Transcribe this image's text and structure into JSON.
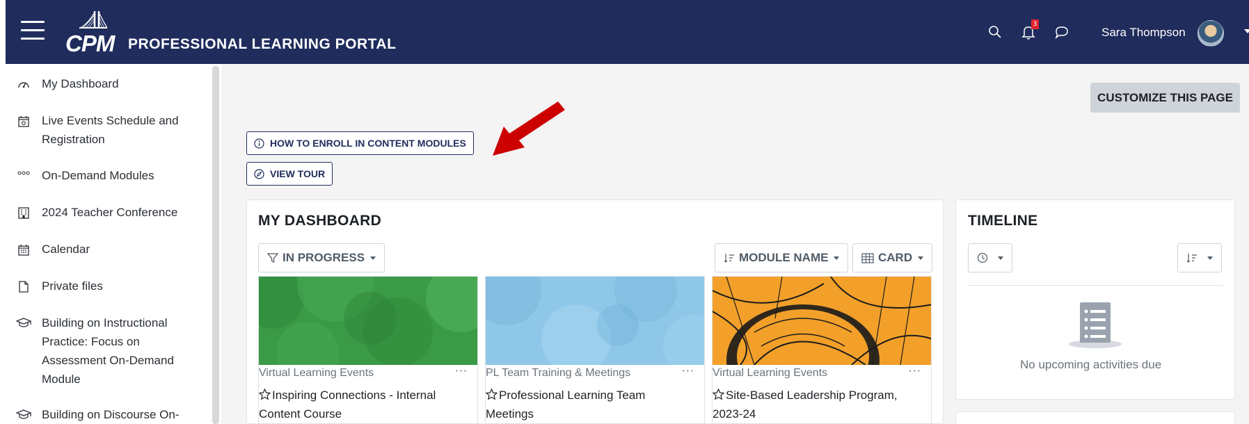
{
  "header": {
    "logo_text": "CPM",
    "portal_title": "PROFESSIONAL LEARNING PORTAL",
    "notification_count": "3",
    "user_name": "Sara Thompson"
  },
  "sidebar": {
    "items": [
      {
        "label": "My Dashboard",
        "icon": "gauge-icon"
      },
      {
        "label": "Live Events Schedule and Registration",
        "icon": "calendar-gear-icon"
      },
      {
        "label": "On-Demand Modules",
        "icon": "dots-icon"
      },
      {
        "label": "2024 Teacher Conference",
        "icon": "building-icon"
      },
      {
        "label": "Calendar",
        "icon": "calendar-icon"
      },
      {
        "label": "Private files",
        "icon": "file-icon"
      },
      {
        "label": "Building on Instructional Practice: Focus on Assessment On-Demand Module",
        "icon": "graduation-cap-icon"
      },
      {
        "label": "Building on Discourse On-",
        "icon": "graduation-cap-icon"
      }
    ]
  },
  "main": {
    "customize_label": "CUSTOMIZE THIS PAGE",
    "enroll_label": "HOW TO ENROLL IN CONTENT MODULES",
    "tour_label": "VIEW TOUR"
  },
  "dashboard": {
    "title": "MY DASHBOARD",
    "filter_label": "IN PROGRESS",
    "sort_label": "MODULE NAME",
    "view_label": "CARD",
    "courses": [
      {
        "category": "Virtual Learning Events",
        "name": "Inspiring Connections - Internal Content Course",
        "color": "#3a9a46"
      },
      {
        "category": "PL Team Training & Meetings",
        "name": "Professional Learning Team Meetings",
        "color": "#8fc7e8"
      },
      {
        "category": "Virtual Learning Events",
        "name": "Site-Based Leadership Program, 2023-24",
        "color": "#f2a02a"
      }
    ],
    "more_glyph": "···"
  },
  "timeline": {
    "title": "TIMELINE",
    "empty_message": "No upcoming activities due"
  },
  "colors": {
    "navbar": "#1f2c5c",
    "arrow": "#cc0000",
    "badge": "#e0262d"
  }
}
